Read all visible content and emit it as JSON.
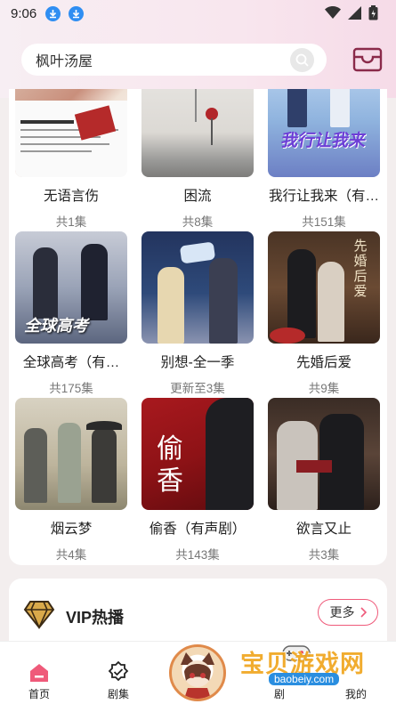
{
  "status": {
    "time": "9:06"
  },
  "search": {
    "query": "枫叶汤屋"
  },
  "grid": [
    {
      "title": "无语言伤",
      "sub": "共1集"
    },
    {
      "title": "困流",
      "sub": "共8集"
    },
    {
      "title": "我行让我来（有…",
      "sub": "共151集"
    },
    {
      "title": "全球高考（有…",
      "sub": "共175集"
    },
    {
      "title": "别想-全一季",
      "sub": "更新至3集"
    },
    {
      "title": "先婚后爱",
      "sub": "共9集"
    },
    {
      "title": "烟云梦",
      "sub": "共4集"
    },
    {
      "title": "偷香（有声剧）",
      "sub": "共143集"
    },
    {
      "title": "欲言又止",
      "sub": "共3集"
    }
  ],
  "cover_text": {
    "c3": "我行让我来",
    "c4": "全球高考",
    "c6": "先婚后爱",
    "c8": "偷香"
  },
  "vip": {
    "title": "VIP热播",
    "more": "更多"
  },
  "nav": {
    "home": "首页",
    "drama": "剧集",
    "search_partial": "剧",
    "mine": "我的"
  },
  "watermark": {
    "main": "宝贝游戏网",
    "url": "baobeiy.com"
  },
  "colors": {
    "accent": "#ef5a7a",
    "download_blue": "#2f8ef2"
  }
}
